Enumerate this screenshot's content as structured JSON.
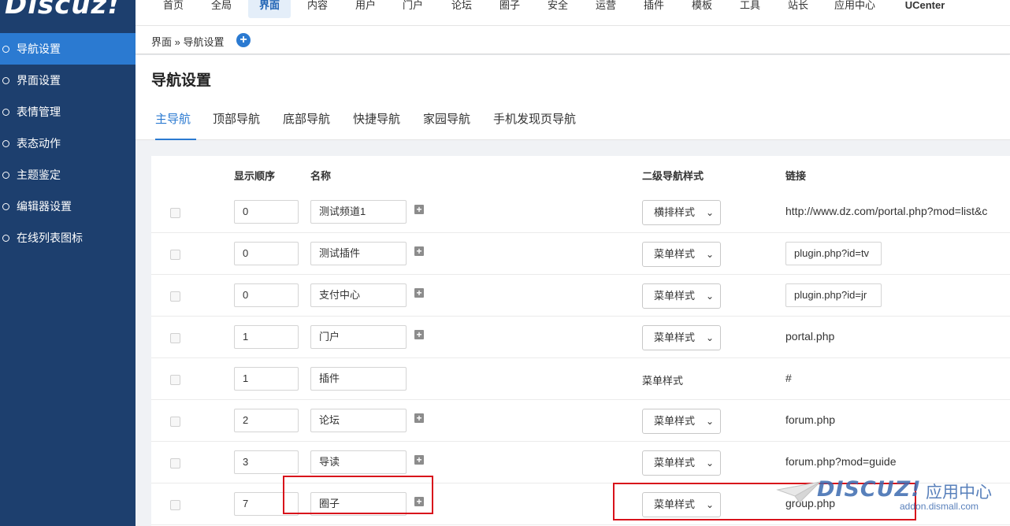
{
  "logo": "Discuz!",
  "topnav": [
    "首页",
    "全局",
    "界面",
    "内容",
    "用户",
    "门户",
    "论坛",
    "圈子",
    "安全",
    "运营",
    "插件",
    "模板",
    "工具",
    "站长",
    "应用中心",
    "UCenter"
  ],
  "topnav_active": "界面",
  "sidebar": {
    "items": [
      {
        "label": "导航设置",
        "active": true
      },
      {
        "label": "界面设置"
      },
      {
        "label": "表情管理"
      },
      {
        "label": "表态动作"
      },
      {
        "label": "主题鉴定"
      },
      {
        "label": "编辑器设置"
      },
      {
        "label": "在线列表图标"
      }
    ]
  },
  "breadcrumb": {
    "parent": "界面",
    "sep": "»",
    "current": "导航设置",
    "add_icon": "+"
  },
  "page_title": "导航设置",
  "tabs": [
    "主导航",
    "顶部导航",
    "底部导航",
    "快捷导航",
    "家园导航",
    "手机发现页导航"
  ],
  "table": {
    "headers": {
      "order": "显示顺序",
      "name": "名称",
      "style": "二级导航样式",
      "link": "链接"
    },
    "rows": [
      {
        "order": "0",
        "name": "测试频道1",
        "plus": "+",
        "style": "横排样式",
        "link": "http://www.dz.com/portal.php?mod=list&c"
      },
      {
        "order": "0",
        "name": "测试插件",
        "plus": "+",
        "style": "菜单样式",
        "link": "plugin.php?id=tv"
      },
      {
        "order": "0",
        "name": "支付中心",
        "plus": "+",
        "style": "菜单样式",
        "link": "plugin.php?id=jr"
      },
      {
        "order": "1",
        "name": "门户",
        "plus": "+",
        "style": "菜单样式",
        "link": "portal.php"
      },
      {
        "order": "1",
        "name": "插件",
        "style": "菜单样式",
        "link": "#"
      },
      {
        "order": "2",
        "name": "论坛",
        "plus": "+",
        "style": "菜单样式",
        "link": "forum.php"
      },
      {
        "order": "3",
        "name": "导读",
        "plus": "+",
        "style": "菜单样式",
        "link": "forum.php?mod=guide"
      },
      {
        "order": "7",
        "name": "圈子",
        "plus": "+",
        "style": "菜单样式",
        "link": "group.php"
      }
    ],
    "dropdown_chevron": "⌄"
  },
  "watermark": {
    "brand": "DISCUZ!",
    "cn": "应用中心",
    "url": "addon.dismall.com"
  },
  "colors": {
    "sidebar": "#1d3f6e",
    "accent": "#2b7ad1",
    "highlight": "#d8121b"
  }
}
